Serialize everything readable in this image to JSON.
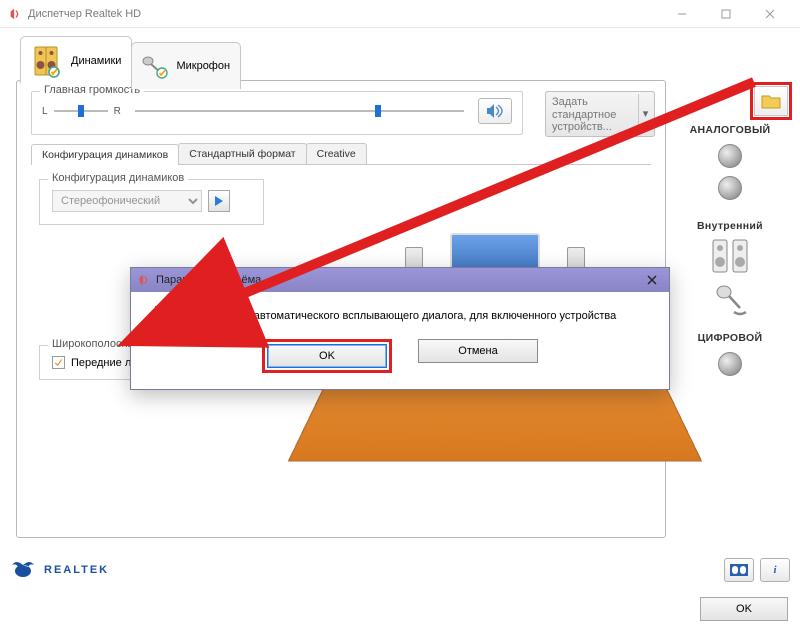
{
  "window": {
    "title": "Диспетчер Realtek HD"
  },
  "tabs": {
    "speakers": "Динамики",
    "mic": "Микрофон"
  },
  "volume": {
    "title": "Главная громкость",
    "L": "L",
    "R": "R"
  },
  "default_device": {
    "line1": "Задать",
    "line2": "стандартное",
    "line3": "устройств..."
  },
  "sub_tabs": {
    "config": "Конфигурация динамиков",
    "format": "Стандартный формат",
    "creative": "Creative"
  },
  "speaker_config": {
    "title": "Конфигурация динамиков",
    "option": "Стереофонический"
  },
  "wideband": {
    "title": "Широкополосные громкоговорители",
    "front": "Передние левый и правый"
  },
  "right": {
    "analog": "АНАЛОГОВЫЙ",
    "internal": "Внутренний",
    "digital": "ЦИФРОВОЙ"
  },
  "brand": "REALTEK",
  "buttons": {
    "ok": "OK"
  },
  "dialog": {
    "title": "Параметры разъёма",
    "checkbox": "Подключение автоматического всплывающего диалога, для включенного устройства",
    "ok": "OK",
    "cancel": "Отмена"
  }
}
